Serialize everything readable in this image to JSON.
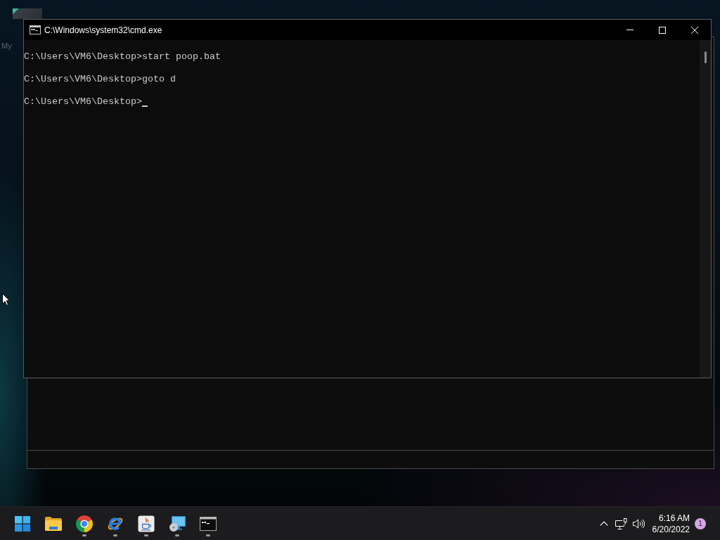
{
  "desktop": {
    "icon_label": "My"
  },
  "window": {
    "title": "C:\\Windows\\system32\\cmd.exe",
    "lines": [
      "C:\\Users\\VM6\\Desktop>start poop.bat",
      "C:\\Users\\VM6\\Desktop>goto d",
      "C:\\Users\\VM6\\Desktop>"
    ],
    "cursor_visible": true
  },
  "taskbar": {
    "apps": [
      {
        "kind": "start",
        "running": false
      },
      {
        "kind": "folder",
        "running": false
      },
      {
        "kind": "chrome",
        "running": true
      },
      {
        "kind": "ie",
        "running": true
      },
      {
        "kind": "java",
        "running": true
      },
      {
        "kind": "installer",
        "running": true
      },
      {
        "kind": "console",
        "running": true
      }
    ]
  },
  "tray": {
    "time": "6:16 AM",
    "date": "6/20/2022",
    "notification_count": "1"
  }
}
